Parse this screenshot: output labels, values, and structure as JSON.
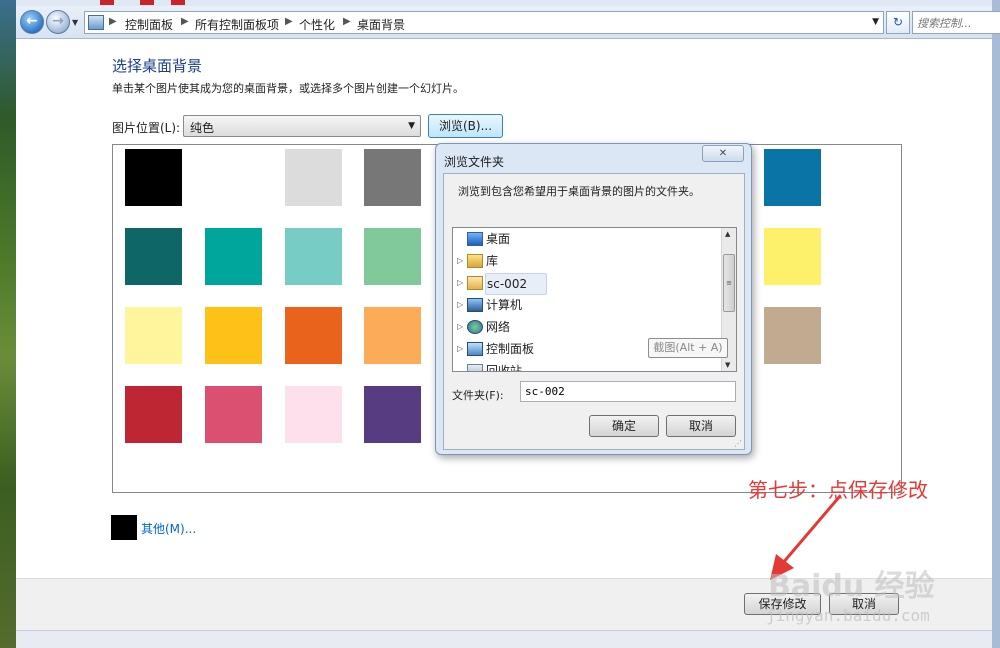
{
  "address_bar": {
    "breadcrumbs": [
      "控制面板",
      "所有控制面板项",
      "个性化",
      "桌面背景"
    ],
    "search_placeholder": "搜索控制..."
  },
  "main": {
    "title": "选择桌面背景",
    "description": "单击某个图片使其成为您的桌面背景，或选择多个图片创建一个幻灯片。",
    "location_label": "图片位置(L):",
    "location_value": "纯色",
    "browse_label": "浏览(B)...",
    "swatch_colors": [
      [
        "#000000",
        "#ffffff",
        "#dcdcdc",
        "#777777",
        "",
        "",
        "",
        "",
        "#0a74a6"
      ],
      [
        "#0e6667",
        "#00a69c",
        "#77ccc6",
        "#81c99b",
        "",
        "",
        "",
        "",
        "#fdf06a"
      ],
      [
        "#fff59c",
        "#fec117",
        "#ea631d",
        "#fcab59",
        "",
        "",
        "",
        "",
        "#c2aa90"
      ],
      [
        "#be2633",
        "#db5070",
        "#fde0ec",
        "#573c81",
        "",
        "",
        "",
        "",
        ""
      ]
    ],
    "peek_colors": [
      "#2e5d9a",
      "#5aa0e4",
      "#c9ecfc"
    ],
    "more_label": "其他(M)...",
    "more_color": "#000000"
  },
  "footer": {
    "save_label": "保存修改",
    "cancel_label": "取消"
  },
  "dialog": {
    "title": "浏览文件夹",
    "close_label": "✕",
    "description": "浏览到包含您希望用于桌面背景的图片的文件夹。",
    "tree": [
      {
        "label": "桌面",
        "expander": "",
        "icon": "desktop-icon"
      },
      {
        "label": "库",
        "expander": "▷",
        "icon": "library-icon"
      },
      {
        "label": "sc-002",
        "expander": "▷",
        "icon": "user-folder-icon"
      },
      {
        "label": "计算机",
        "expander": "▷",
        "icon": "computer-icon"
      },
      {
        "label": "网络",
        "expander": "▷",
        "icon": "network-icon"
      },
      {
        "label": "控制面板",
        "expander": "▷",
        "icon": "control-panel-icon"
      },
      {
        "label": "回收站",
        "expander": "",
        "icon": "recycle-bin-icon"
      }
    ],
    "snip_tooltip": "截图(Alt + A)",
    "folder_label": "文件夹(F):",
    "folder_value": "sc-002",
    "ok_label": "确定",
    "cancel_label": "取消"
  },
  "annotation": {
    "text": "第七步：点保存修改",
    "color": "#e53935"
  },
  "watermark": {
    "main": "Baidu 经验",
    "sub": "jingyan.baidu.com"
  }
}
